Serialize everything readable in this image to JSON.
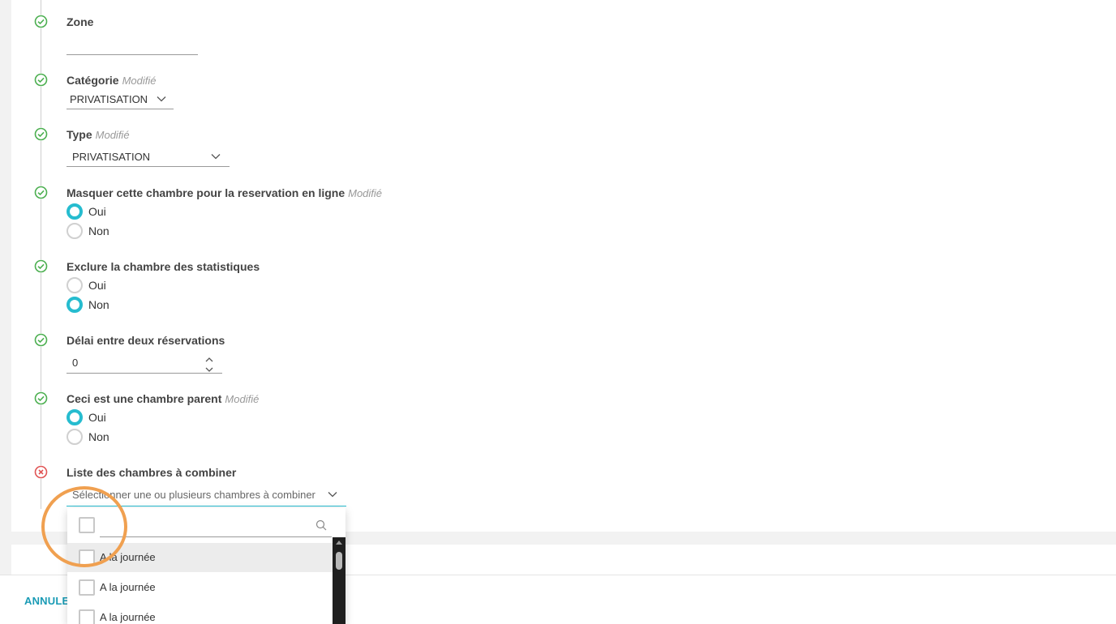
{
  "form": {
    "modified_tag": "Modifié",
    "zone": {
      "label": "Zone",
      "value": ""
    },
    "categorie": {
      "label": "Catégorie",
      "value": "PRIVATISATION"
    },
    "type": {
      "label": "Type",
      "value": "PRIVATISATION"
    },
    "masquer": {
      "label": "Masquer cette chambre pour la reservation en ligne",
      "options": [
        "Oui",
        "Non"
      ],
      "selected": "Oui"
    },
    "exclure": {
      "label": "Exclure la chambre des statistiques",
      "options": [
        "Oui",
        "Non"
      ],
      "selected": "Non"
    },
    "delai": {
      "label": "Délai entre deux réservations",
      "value": "0"
    },
    "parent": {
      "label": "Ceci est une chambre parent",
      "options": [
        "Oui",
        "Non"
      ],
      "selected": "Oui"
    },
    "liste": {
      "label": "Liste des chambres à combiner",
      "placeholder": "Sélectionner une ou plusieurs chambres à combiner"
    }
  },
  "dropdown": {
    "items": [
      "A la journée",
      "A la journée",
      "A la journée"
    ]
  },
  "footer": {
    "cancel_label": "ANNULER"
  },
  "colors": {
    "accent": "#26bccf",
    "success": "#4caf50",
    "error": "#e05555",
    "highlight": "#f0a050",
    "cancel_text": "#1a9bb5"
  },
  "icons": {
    "step_ok": "check-circle-icon",
    "step_error": "x-circle-icon"
  }
}
